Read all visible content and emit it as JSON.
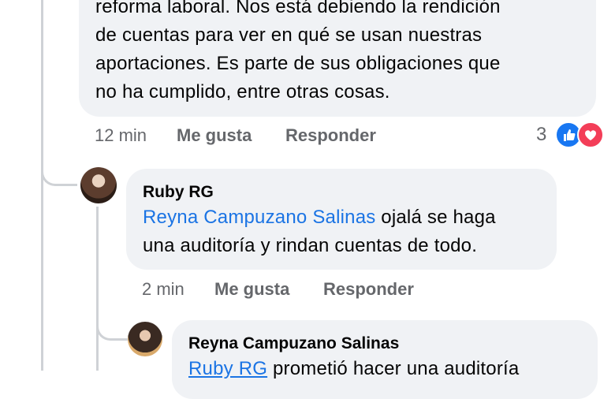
{
  "comment1": {
    "lines": [
      "reforma laboral. Nos está debiendo la rendición",
      "de cuentas para ver en qué se usan nuestras",
      "aportaciones. Es parte de sus obligaciones que",
      "no ha cumplido, entre otras cosas."
    ],
    "time": "12 min",
    "like": "Me gusta",
    "reply": "Responder",
    "reaction_count": "3",
    "reactions": [
      "like-icon",
      "love-icon"
    ]
  },
  "comment2": {
    "author": "Ruby RG",
    "mention": "Reyna Campuzano Salinas",
    "line1_rest": " ojalá se haga",
    "line2": "una auditoría y rindan cuentas de todo.",
    "time": "2 min",
    "like": "Me gusta",
    "reply": "Responder"
  },
  "comment3": {
    "author": "Reyna Campuzano Salinas",
    "mention": "Ruby RG",
    "line1_rest": " prometió  hacer una auditoría"
  },
  "colors": {
    "bubble": "#f0f2f5",
    "mention": "#1b74e4",
    "meta": "#65676b",
    "like_blue": "#1877f2",
    "love_red": "#f33e58"
  }
}
